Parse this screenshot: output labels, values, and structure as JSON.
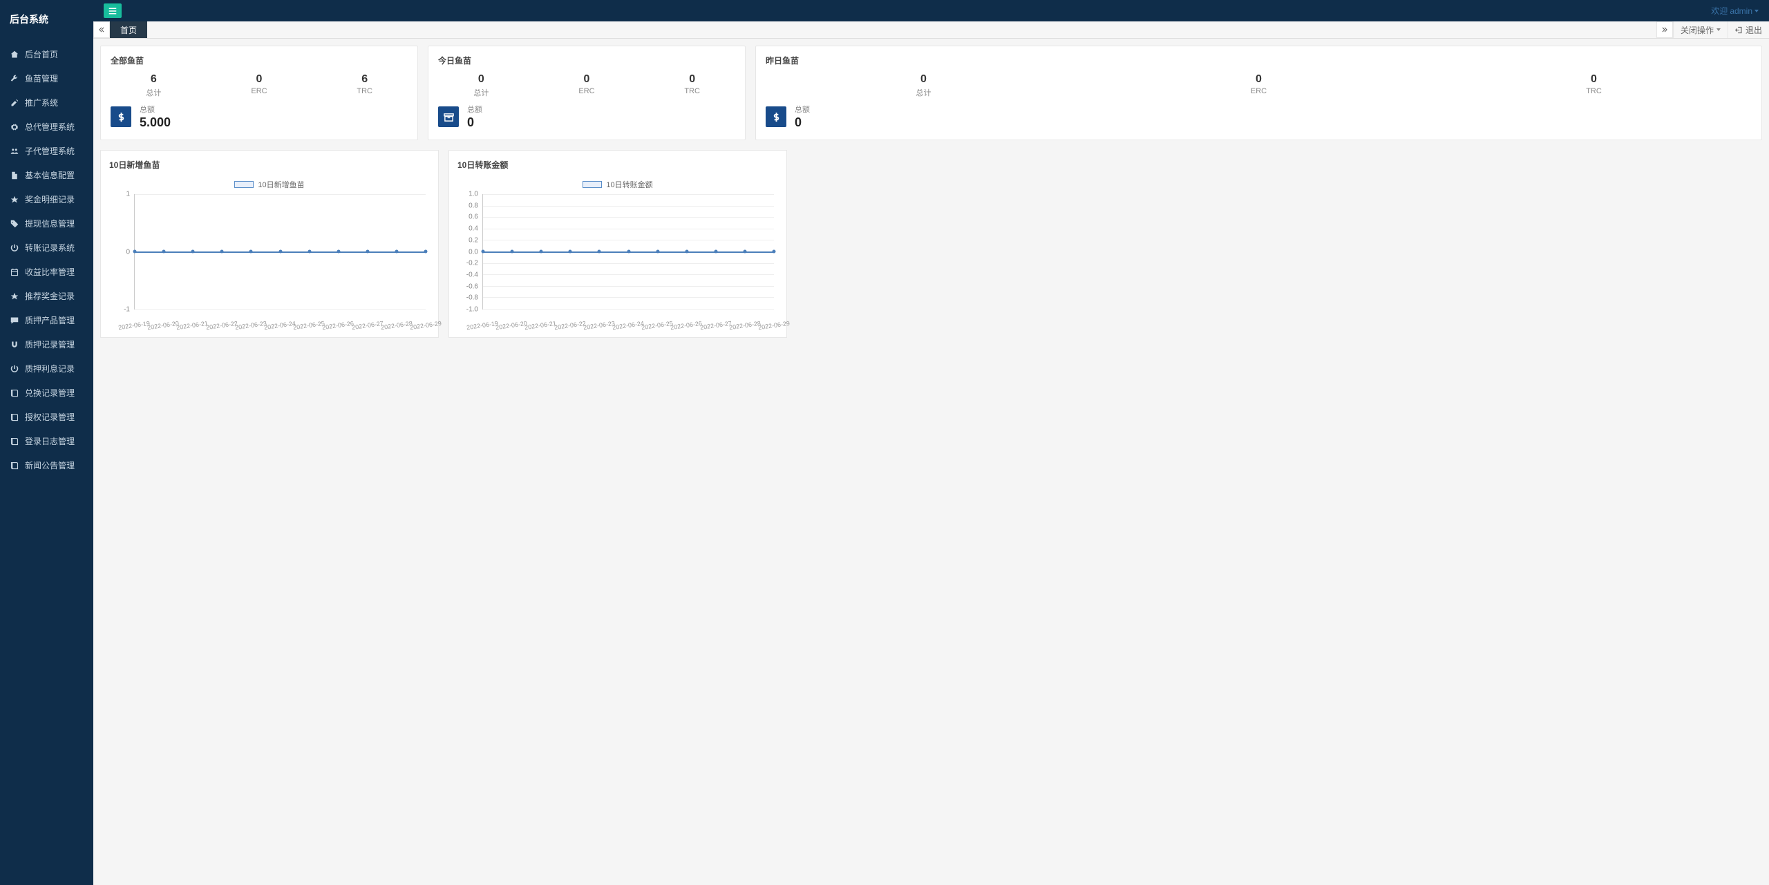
{
  "app_title": "后台系统",
  "header": {
    "welcome_prefix": "欢迎 ",
    "username": "admin"
  },
  "sidebar": {
    "items": [
      {
        "icon": "home",
        "label": "后台首页"
      },
      {
        "icon": "wrench",
        "label": "鱼苗管理"
      },
      {
        "icon": "edit",
        "label": "推广系统"
      },
      {
        "icon": "gear",
        "label": "总代管理系统"
      },
      {
        "icon": "users",
        "label": "子代管理系统"
      },
      {
        "icon": "file",
        "label": "基本信息配置"
      },
      {
        "icon": "star",
        "label": "奖金明细记录"
      },
      {
        "icon": "tag",
        "label": "提现信息管理"
      },
      {
        "icon": "power",
        "label": "转账记录系统"
      },
      {
        "icon": "calendar",
        "label": "收益比率管理"
      },
      {
        "icon": "star",
        "label": "推荐奖金记录"
      },
      {
        "icon": "comment",
        "label": "质押产品管理"
      },
      {
        "icon": "magnet",
        "label": "质押记录管理"
      },
      {
        "icon": "power",
        "label": "质押利息记录"
      },
      {
        "icon": "book",
        "label": "兑换记录管理"
      },
      {
        "icon": "book",
        "label": "授权记录管理"
      },
      {
        "icon": "book",
        "label": "登录日志管理"
      },
      {
        "icon": "book",
        "label": "新闻公告管理"
      }
    ]
  },
  "tabs": {
    "home": "首页",
    "close_ops": "关闭操作",
    "exit": "退出"
  },
  "cards": [
    {
      "title": "全部鱼苗",
      "stats": [
        {
          "value": "6",
          "label": "总计"
        },
        {
          "value": "0",
          "label": "ERC"
        },
        {
          "value": "6",
          "label": "TRC"
        }
      ],
      "total": {
        "label": "总额",
        "value": "5.000",
        "icon": "dollar"
      }
    },
    {
      "title": "今日鱼苗",
      "stats": [
        {
          "value": "0",
          "label": "总计"
        },
        {
          "value": "0",
          "label": "ERC"
        },
        {
          "value": "0",
          "label": "TRC"
        }
      ],
      "total": {
        "label": "总额",
        "value": "0",
        "icon": "archive"
      }
    },
    {
      "title": "昨日鱼苗",
      "stats": [
        {
          "value": "0",
          "label": "总计"
        },
        {
          "value": "0",
          "label": "ERC"
        },
        {
          "value": "0",
          "label": "TRC"
        }
      ],
      "total": {
        "label": "总额",
        "value": "0",
        "icon": "dollar"
      }
    }
  ],
  "charts": [
    {
      "title": "10日新增鱼苗",
      "legend": "10日新增鱼苗"
    },
    {
      "title": "10日转账金额",
      "legend": "10日转账金额"
    }
  ],
  "chart_data": [
    {
      "type": "line",
      "title": "10日新增鱼苗",
      "series": [
        {
          "name": "10日新增鱼苗",
          "values": [
            0,
            0,
            0,
            0,
            0,
            0,
            0,
            0,
            0,
            0,
            0
          ]
        }
      ],
      "categories": [
        "2022-06-19",
        "2022-06-20",
        "2022-06-21",
        "2022-06-22",
        "2022-06-23",
        "2022-06-24",
        "2022-06-25",
        "2022-06-26",
        "2022-06-27",
        "2022-06-28",
        "2022-06-29"
      ],
      "ylabel": "",
      "xlabel": "",
      "ylim": [
        -1,
        1
      ],
      "yticks": [
        -1,
        0,
        1
      ]
    },
    {
      "type": "line",
      "title": "10日转账金额",
      "series": [
        {
          "name": "10日转账金额",
          "values": [
            0,
            0,
            0,
            0,
            0,
            0,
            0,
            0,
            0,
            0,
            0
          ]
        }
      ],
      "categories": [
        "2022-06-19",
        "2022-06-20",
        "2022-06-21",
        "2022-06-22",
        "2022-06-23",
        "2022-06-24",
        "2022-06-25",
        "2022-06-26",
        "2022-06-27",
        "2022-06-28",
        "2022-06-29"
      ],
      "ylabel": "",
      "xlabel": "",
      "ylim": [
        -1.0,
        1.0
      ],
      "yticks": [
        -1.0,
        -0.8,
        -0.6,
        -0.4,
        -0.2,
        0,
        0.2,
        0.4,
        0.6,
        0.8,
        1.0
      ]
    }
  ]
}
